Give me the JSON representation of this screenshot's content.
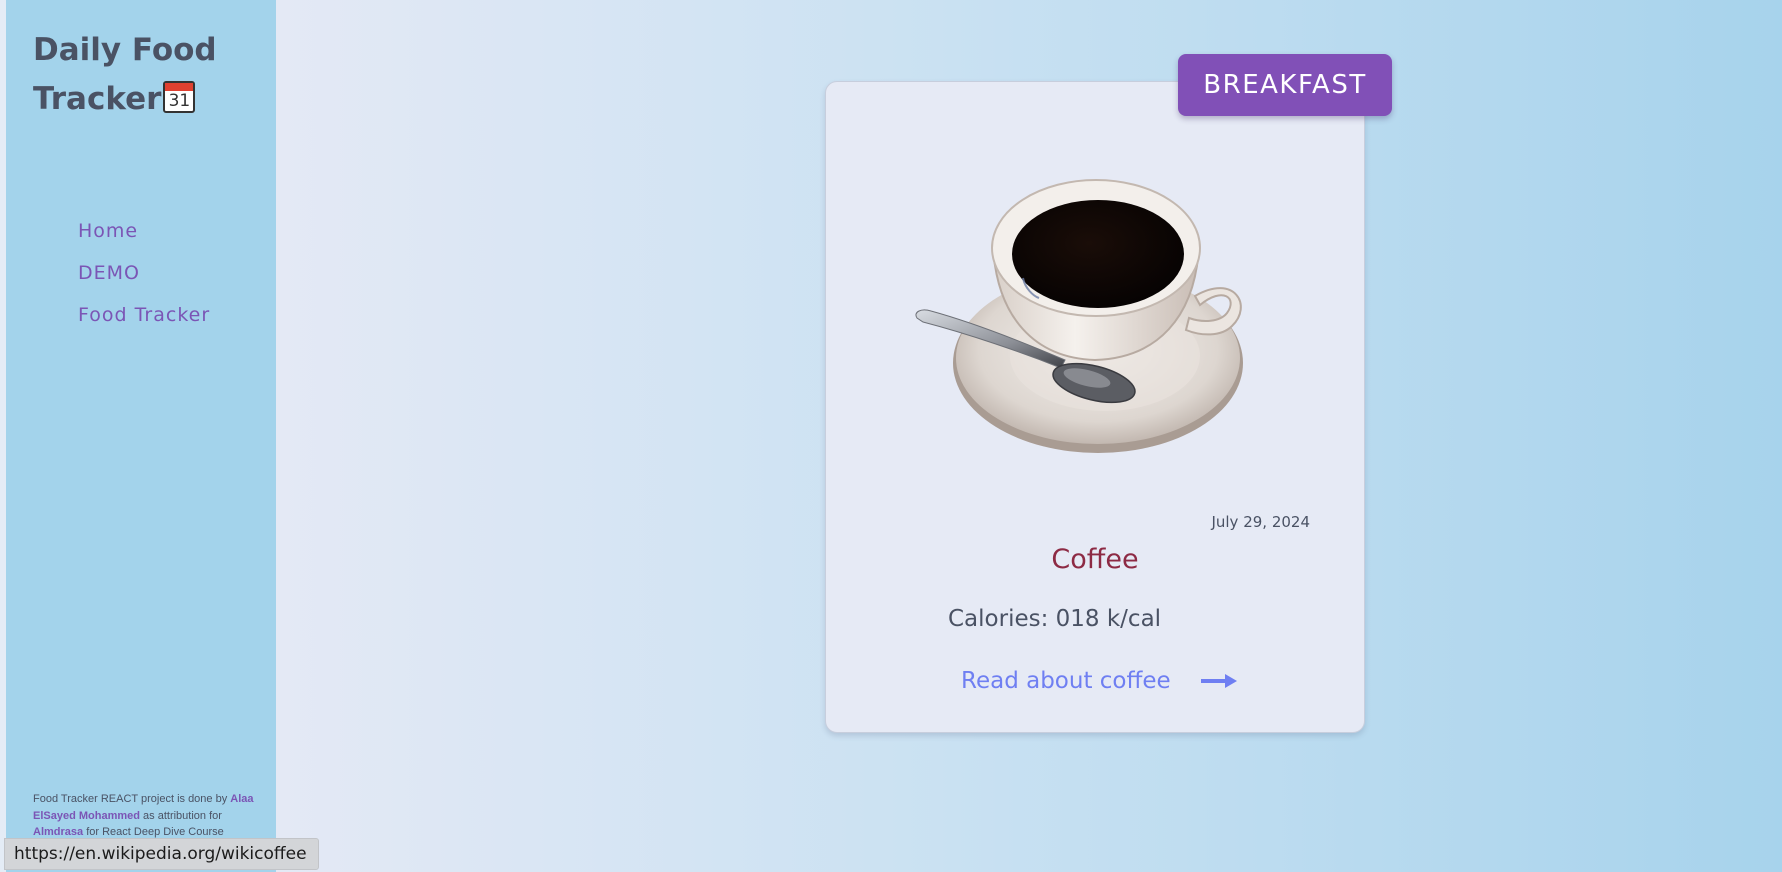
{
  "sidebar": {
    "title": "Daily Food Tracker",
    "title_icon": "calendar-icon",
    "calendar_day": "31",
    "nav": [
      {
        "label": "Home"
      },
      {
        "label": "DEMO"
      },
      {
        "label": "Food Tracker"
      }
    ],
    "footer": {
      "line_start": "Food Tracker REACT project is done by",
      "author": "Alaa ElSayed Mohammed",
      "attribution": "as attribution for",
      "org": "Almdrasa",
      "course": "for React Deep Dive Course"
    }
  },
  "card": {
    "meal_badge": "BREAKFAST",
    "image_icon": "coffee-cup-icon",
    "date": "July 29, 2024",
    "food_name": "Coffee",
    "calories": "Calories: 018 k/cal",
    "read_link": "Read about coffee",
    "link_icon": "arrow-right-icon"
  },
  "status_url": "https://en.wikipedia.org/wikicoffee",
  "colors": {
    "sidebar_bg": "#a3d3eb",
    "accent_purple": "#8150b7",
    "food_name": "#8d2a44",
    "link": "#6f7ff2",
    "text_dark": "#4a5264"
  }
}
